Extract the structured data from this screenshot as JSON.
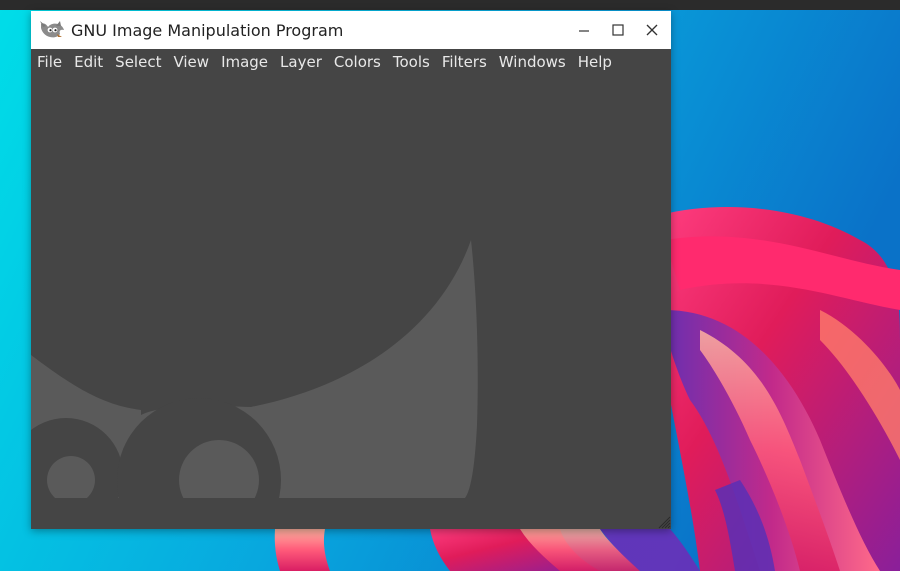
{
  "window": {
    "title": "GNU Image Manipulation Program",
    "app_icon": "wilber-icon",
    "controls": {
      "minimize": "minimize-icon",
      "maximize": "maximize-icon",
      "close": "close-icon"
    }
  },
  "menubar": {
    "items": [
      "File",
      "Edit",
      "Select",
      "View",
      "Image",
      "Layer",
      "Colors",
      "Tools",
      "Filters",
      "Windows",
      "Help"
    ]
  },
  "colors": {
    "window_bg": "#454545",
    "watermark": "#5a5a5a",
    "menu_text": "#e8e8e8",
    "titlebar_bg": "#ffffff",
    "desktop_cyan": "#00d4e6",
    "desktop_blue": "#0a7fd2",
    "ribbon_pink": "#e8215f",
    "ribbon_purple": "#8a2fa8"
  }
}
